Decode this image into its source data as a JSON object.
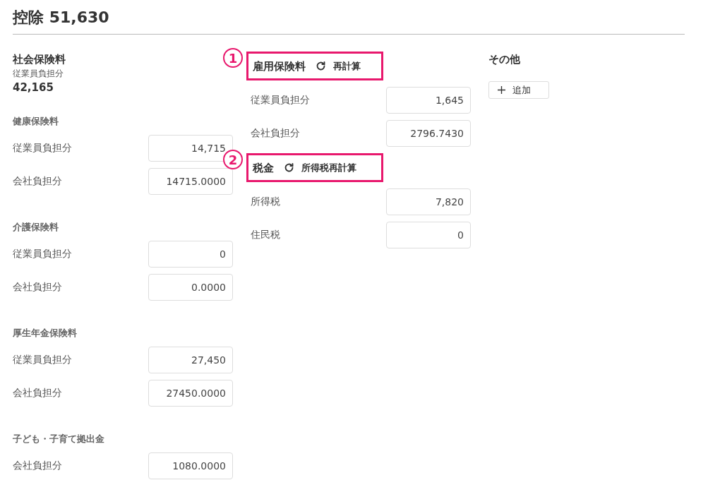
{
  "title": "控除 51,630",
  "social_insurance": {
    "title": "社会保険料",
    "subtitle": "従業員負担分",
    "total": "42,165",
    "groups": [
      {
        "title": "健康保険料",
        "rows": [
          {
            "label": "従業員負担分",
            "value": "14,715"
          },
          {
            "label": "会社負担分",
            "value": "14715.0000"
          }
        ]
      },
      {
        "title": "介護保険料",
        "rows": [
          {
            "label": "従業員負担分",
            "value": "0"
          },
          {
            "label": "会社負担分",
            "value": "0.0000"
          }
        ]
      },
      {
        "title": "厚生年金保険料",
        "rows": [
          {
            "label": "従業員負担分",
            "value": "27,450"
          },
          {
            "label": "会社負担分",
            "value": "27450.0000"
          }
        ]
      },
      {
        "title": "子ども・子育て拠出金",
        "rows": [
          {
            "label": "会社負担分",
            "value": "1080.0000"
          }
        ]
      }
    ]
  },
  "sections": [
    {
      "title": "雇用保険料",
      "action": "再計算",
      "callout": "1",
      "rows": [
        {
          "label": "従業員負担分",
          "value": "1,645"
        },
        {
          "label": "会社負担分",
          "value": "2796.7430"
        }
      ]
    },
    {
      "title": "税金",
      "action": "所得税再計算",
      "callout": "2",
      "rows": [
        {
          "label": "所得税",
          "value": "7,820"
        },
        {
          "label": "住民税",
          "value": "0"
        }
      ]
    }
  ],
  "other": {
    "title": "その他",
    "add_button": "追加"
  }
}
